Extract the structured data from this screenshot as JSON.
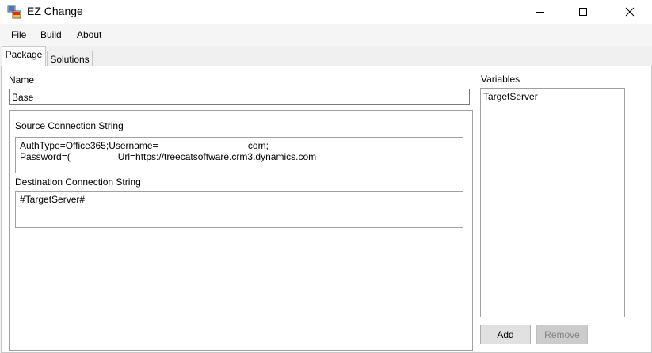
{
  "window": {
    "title": "EZ Change",
    "controls": {
      "minimize_icon": "minimize-icon",
      "maximize_icon": "maximize-icon",
      "close_icon": "close-icon"
    }
  },
  "menu": [
    {
      "label": "File"
    },
    {
      "label": "Build"
    },
    {
      "label": "About"
    }
  ],
  "tabs": [
    {
      "label": "Package",
      "active": true
    },
    {
      "label": "Solutions",
      "active": false
    }
  ],
  "package": {
    "name_label": "Name",
    "name_value": "Base",
    "source_label": "Source Connection String",
    "source_value": "AuthType=Office365;Username=                                  com;\nPassword=(                  Url=https://treecatsoftware.crm3.dynamics.com",
    "destination_label": "Destination Connection String",
    "destination_value": "#TargetServer#"
  },
  "variables": {
    "label": "Variables",
    "items": [
      "TargetServer"
    ],
    "add_label": "Add",
    "remove_label": "Remove"
  },
  "colors": {
    "disabled_button": "#cccccc",
    "border": "#7a7a7a"
  }
}
